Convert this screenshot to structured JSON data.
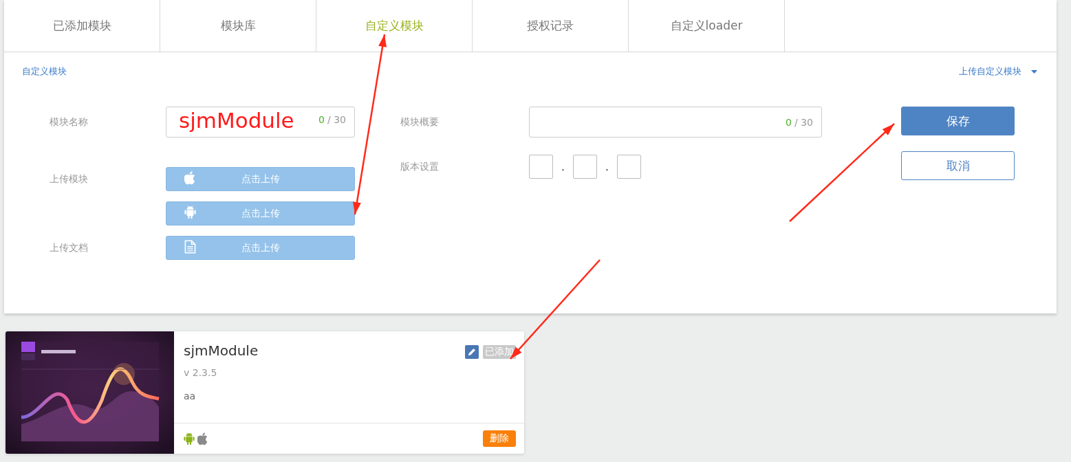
{
  "tabs": [
    {
      "label": "已添加模块",
      "selected": false
    },
    {
      "label": "模块库",
      "selected": false
    },
    {
      "label": "自定义模块",
      "selected": true
    },
    {
      "label": "授权记录",
      "selected": false
    },
    {
      "label": "自定义loader",
      "selected": false
    }
  ],
  "breadcrumb": "自定义模块",
  "upload_menu": {
    "label": "上传自定义模块"
  },
  "name_field": {
    "label": "模块名称",
    "value": "sjmModule",
    "count": "0",
    "max": "/ 30"
  },
  "upload_sections": [
    {
      "label": "上传模块",
      "buttons": [
        {
          "kind": "apple",
          "text": "点击上传"
        },
        {
          "kind": "android",
          "text": "点击上传"
        }
      ]
    },
    {
      "label": "上传文档",
      "buttons": [
        {
          "kind": "document",
          "text": "点击上传"
        }
      ]
    }
  ],
  "summary_field": {
    "label": "模块概要",
    "count": "0",
    "max": "/ 30"
  },
  "version": {
    "label": "版本设置",
    "separators": [
      ".",
      "."
    ]
  },
  "actions": [
    {
      "kind": "primary",
      "label": "保存"
    },
    {
      "kind": "outline",
      "label": "取消"
    }
  ],
  "module_card": {
    "title": "sjmModule",
    "version": "v 2.3.5",
    "description": "aa",
    "status": "已添加",
    "platforms": [
      {
        "kind": "android"
      },
      {
        "kind": "apple"
      }
    ],
    "delete": "删除"
  }
}
